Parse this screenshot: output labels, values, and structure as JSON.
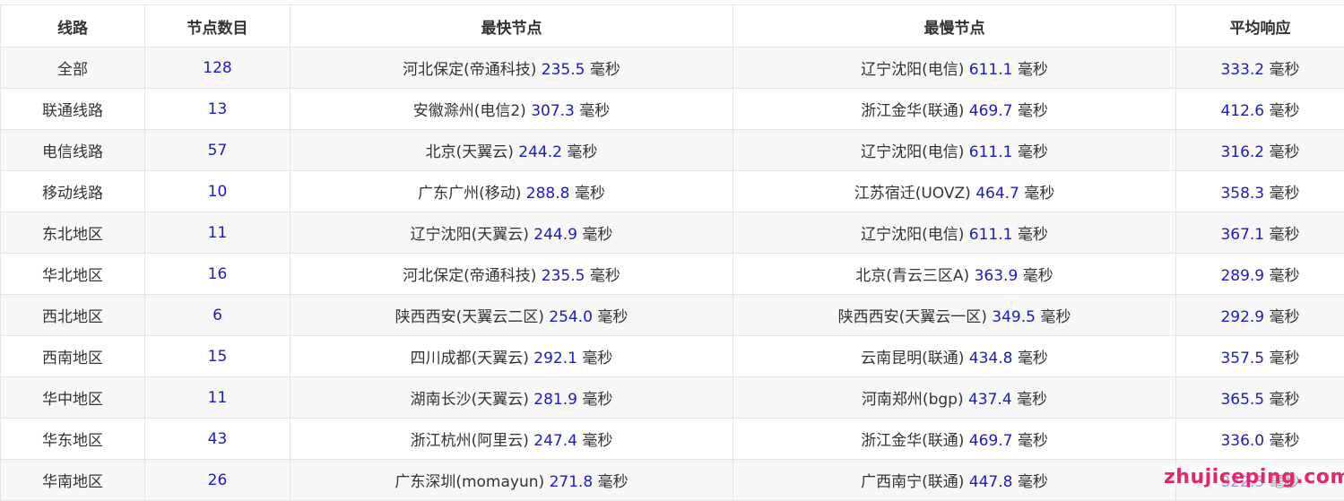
{
  "headers": [
    "线路",
    "节点数目",
    "最快节点",
    "最慢节点",
    "平均响应"
  ],
  "unit": "毫秒",
  "rows": [
    {
      "line": "全部",
      "count": "128",
      "fast_name": "河北保定(帝通科技)",
      "fast_ms": "235.5",
      "slow_name": "辽宁沈阳(电信)",
      "slow_ms": "611.1",
      "avg_ms": "333.2"
    },
    {
      "line": "联通线路",
      "count": "13",
      "fast_name": "安徽滁州(电信2)",
      "fast_ms": "307.3",
      "slow_name": "浙江金华(联通)",
      "slow_ms": "469.7",
      "avg_ms": "412.6"
    },
    {
      "line": "电信线路",
      "count": "57",
      "fast_name": "北京(天翼云)",
      "fast_ms": "244.2",
      "slow_name": "辽宁沈阳(电信)",
      "slow_ms": "611.1",
      "avg_ms": "316.2"
    },
    {
      "line": "移动线路",
      "count": "10",
      "fast_name": "广东广州(移动)",
      "fast_ms": "288.8",
      "slow_name": "江苏宿迁(UOVZ)",
      "slow_ms": "464.7",
      "avg_ms": "358.3"
    },
    {
      "line": "东北地区",
      "count": "11",
      "fast_name": "辽宁沈阳(天翼云)",
      "fast_ms": "244.9",
      "slow_name": "辽宁沈阳(电信)",
      "slow_ms": "611.1",
      "avg_ms": "367.1"
    },
    {
      "line": "华北地区",
      "count": "16",
      "fast_name": "河北保定(帝通科技)",
      "fast_ms": "235.5",
      "slow_name": "北京(青云三区A)",
      "slow_ms": "363.9",
      "avg_ms": "289.9"
    },
    {
      "line": "西北地区",
      "count": "6",
      "fast_name": "陕西西安(天翼云二区)",
      "fast_ms": "254.0",
      "slow_name": "陕西西安(天翼云一区)",
      "slow_ms": "349.5",
      "avg_ms": "292.9"
    },
    {
      "line": "西南地区",
      "count": "15",
      "fast_name": "四川成都(天翼云)",
      "fast_ms": "292.1",
      "slow_name": "云南昆明(联通)",
      "slow_ms": "434.8",
      "avg_ms": "357.5"
    },
    {
      "line": "华中地区",
      "count": "11",
      "fast_name": "湖南长沙(天翼云)",
      "fast_ms": "281.9",
      "slow_name": "河南郑州(bgp)",
      "slow_ms": "437.4",
      "avg_ms": "365.5"
    },
    {
      "line": "华东地区",
      "count": "43",
      "fast_name": "浙江杭州(阿里云)",
      "fast_ms": "247.4",
      "slow_name": "浙江金华(联通)",
      "slow_ms": "469.7",
      "avg_ms": "336.0"
    },
    {
      "line": "华南地区",
      "count": "26",
      "fast_name": "广东深圳(momayun)",
      "fast_ms": "271.8",
      "slow_name": "广西南宁(联通)",
      "slow_ms": "447.8",
      "avg_ms": "322.3"
    }
  ],
  "watermark": "zhujiceping.com",
  "colors": {
    "number": "#1a1acc",
    "text": "#333333",
    "watermark": "#e8256a",
    "stripe": "#f7f7f7",
    "border": "#e5e5e5"
  }
}
